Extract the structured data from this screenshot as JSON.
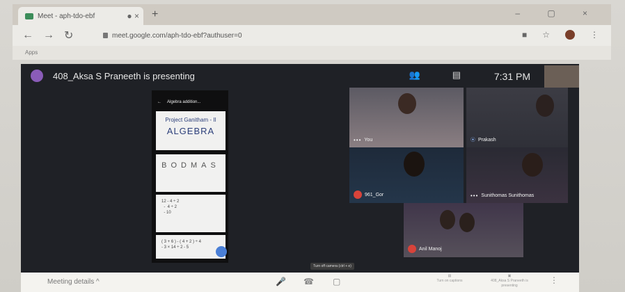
{
  "browser": {
    "tab_title": "Meet - aph-tdo-ebf",
    "tab_dot": "● ×",
    "new_tab": "+",
    "window_controls": "– ▢ ×",
    "url": "meet.google.com/aph-tdo-ebf?authuser=0",
    "bookmarks_label": "Apps"
  },
  "meet": {
    "presenting_text": "408_Aksa S Praneeth is presenting",
    "clock": "7:31 PM",
    "slide": {
      "status": "",
      "app_title": "Algebra addition...",
      "card1_line1": "Project Ganitham - II",
      "card1_line2": "ALGEBRA",
      "card2_text": "BODMAS",
      "card3_text": "12 - 4 ÷ 2\n  -  4 ÷ 2\n  - 10",
      "card4_text": "( 3 + 6 ) - ( 4 + 2 ) ÷ 4\n- 3 × 14 ÷ 2 - 5"
    },
    "participants": [
      {
        "name": "You",
        "muted": false
      },
      {
        "name": "Prakash",
        "muted": false
      },
      {
        "name": "961_Gor",
        "muted": true
      },
      {
        "name": "Sunithomas Sunithomas",
        "muted": false
      },
      {
        "name": "Anil Manoj",
        "muted": true
      }
    ]
  },
  "bottombar": {
    "meeting_details": "Meeting details ^",
    "tooltip": "Turn off camera (ctrl + e)",
    "captions": "Turn on captions",
    "presenting": "408_Aksa S Praneeth is presenting"
  },
  "colors": {
    "meet_bg": "#1f2126",
    "mic_muted": "#d8433a",
    "accent": "#4a7fd6"
  }
}
